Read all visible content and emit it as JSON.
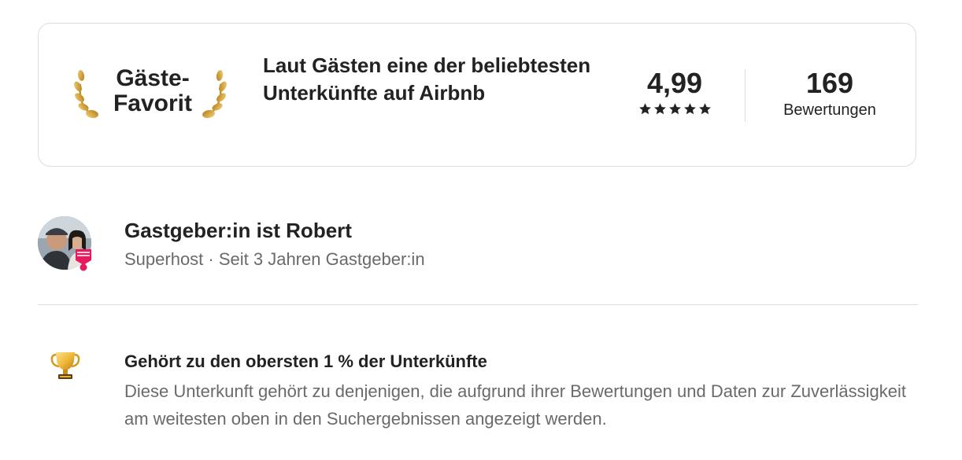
{
  "guest_favorite": {
    "label": "Gäste-\nFavorit",
    "description": "Laut Gästen eine der beliebtesten Unterkünfte auf Airbnb",
    "rating": "4,99",
    "stars": 5,
    "reviews_count": "169",
    "reviews_label": "Bewertungen",
    "icons": [
      "laurel-left-icon",
      "laurel-right-icon",
      "star-icon"
    ]
  },
  "host": {
    "title": "Gastgeber:in ist Robert",
    "subtitle": "Superhost · Seit 3 Jahren Gastgeber:in",
    "icons": [
      "avatar",
      "superhost-badge-icon"
    ]
  },
  "highlight": {
    "title": "Gehört zu den obersten 1 % der Unterkünfte",
    "description": "Diese Unterkunft gehört zu denjenigen, die aufgrund ihrer Bewertungen und Daten zur Zuverlässigkeit am weitesten oben in den Suchergebnissen angezeigt werden.",
    "icon": "trophy-icon"
  },
  "colors": {
    "text_primary": "#222222",
    "text_secondary": "#6a6a6a",
    "border": "#dddddd",
    "gold": "#d7a12a",
    "superhost_pink": "#e31c5f"
  }
}
